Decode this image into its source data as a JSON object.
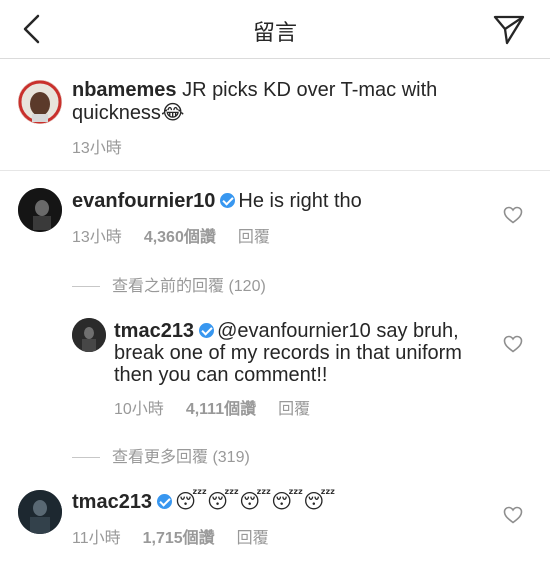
{
  "header": {
    "title": "留言"
  },
  "caption": {
    "username": "nbamemes",
    "text": "JR picks KD over T-mac with quickness",
    "emoji": "😂",
    "time": "13小時"
  },
  "comments": [
    {
      "username": "evanfournier10",
      "text": "He is right tho",
      "time": "13小時",
      "likes": "4,360個讚",
      "reply_label": "回覆",
      "view_replies": "查看之前的回覆 (120)",
      "replies": [
        {
          "username": "tmac213",
          "mention": "@evanfournier10",
          "text_line1": " say bruh,",
          "text_line2": "break one of my records in that uniform",
          "text_line3": "then you can comment!!",
          "time": "10小時",
          "likes": "4,111個讚",
          "reply_label": "回覆"
        }
      ],
      "view_more_replies": "查看更多回覆 (319)"
    },
    {
      "username": "tmac213",
      "text": "😴😴😴😴😴",
      "time": "11小時",
      "likes": "1,715個讚",
      "reply_label": "回覆"
    }
  ],
  "colors": {
    "text": "#262626",
    "secondary": "#999999",
    "verified": "#3897f0",
    "divider": "#dbdbdb"
  }
}
